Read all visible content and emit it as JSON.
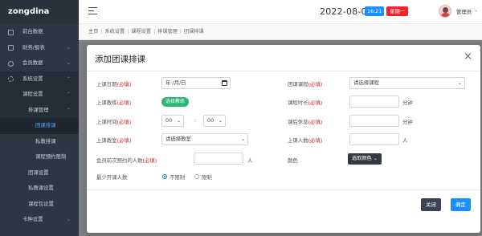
{
  "brand": "zongdina",
  "sidebar": {
    "items": [
      {
        "label": "前台数据",
        "icon": "monitor-icon"
      },
      {
        "label": "财务/报表",
        "icon": "document-icon"
      },
      {
        "label": "会员数据",
        "icon": "user-icon"
      },
      {
        "label": "系统设置",
        "icon": "gear-icon"
      },
      {
        "label": "课程设置"
      },
      {
        "label": "排课管理"
      },
      {
        "label": "团课排课"
      },
      {
        "label": "私教排课"
      },
      {
        "label": "课程预约限制"
      },
      {
        "label": "团课设置"
      },
      {
        "label": "私教课设置"
      },
      {
        "label": "课程包设置"
      },
      {
        "label": "卡种设置"
      }
    ]
  },
  "header": {
    "date": "2022-08-01",
    "time": "16:21",
    "weekday": "星期一",
    "username": "管理员"
  },
  "breadcrumb": [
    "主页",
    "系统设置",
    "课程设置",
    "排课管理",
    "团课排课"
  ],
  "modal": {
    "title": "添加团课排课",
    "required_mark": "(必填)",
    "labels": {
      "date": "上课日期",
      "course": "团课课程",
      "coach": "上课教练",
      "duration": "课程时长",
      "time": "上课时间",
      "rest": "课后休息",
      "room": "上课教室",
      "capacity": "上课人数",
      "advance_limit": "会员前次预约的人数",
      "color": "颜色",
      "min_people": "最少开课人数"
    },
    "date_value": "年 /月/日",
    "course_placeholder": "请选择课程",
    "coach_button": "选择教练",
    "duration_value": "",
    "minute_unit": "分钟",
    "hour_value": "00",
    "minute_value": "00",
    "time_sep": ":",
    "rest_value": "",
    "room_placeholder": "请选择教室",
    "capacity_value": "",
    "people_unit": "人",
    "advance_value": "",
    "color_button": "选取颜色",
    "radio_unlimited": "不限制",
    "radio_limited": "限制",
    "btn_close": "关闭",
    "btn_confirm": "确定"
  }
}
